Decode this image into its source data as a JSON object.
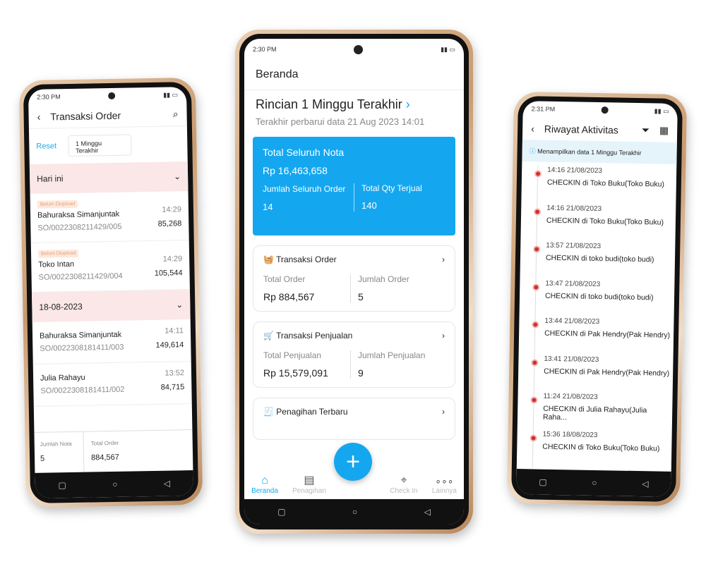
{
  "left": {
    "time": "2:30 PM",
    "title": "Transaksi Order",
    "reset": "Reset",
    "filter": "1 Minggu Terakhir",
    "groups": [
      {
        "label": "Hari ini",
        "orders": [
          {
            "badge": "Belum Diupload",
            "name": "Bahuraksa Simanjuntak",
            "time": "14:29",
            "so": "SO/0022308211429/005",
            "amount": "85,268"
          },
          {
            "badge": "Belum Diupload",
            "name": "Toko Intan",
            "time": "14:29",
            "so": "SO/0022308211429/004",
            "amount": "105,544"
          }
        ]
      },
      {
        "label": "18-08-2023",
        "orders": [
          {
            "name": "Bahuraksa Simanjuntak",
            "time": "14:11",
            "so": "SO/0022308181411/003",
            "amount": "149,614"
          },
          {
            "name": "Julia Rahayu",
            "time": "13:52",
            "so": "SO/0022308181411/002",
            "amount": "84,715"
          }
        ]
      }
    ],
    "footer": {
      "nota_label": "Jumlah Nota",
      "nota": "5",
      "total_label": "Total Order",
      "total": "884,567"
    }
  },
  "middle": {
    "time": "2:30 PM",
    "title": "Beranda",
    "heading": "Rincian 1 Minggu Terakhir",
    "updated": "Terakhir perbarui data 21 Aug 2023 14:01",
    "summary": {
      "label": "Total Seluruh Nota",
      "value": "Rp 16,463,658",
      "a_label": "Jumlah Seluruh Order",
      "a": "14",
      "b_label": "Total Qty Terjual",
      "b": "140"
    },
    "cards": [
      {
        "title": "Transaksi Order",
        "l_label": "Total Order",
        "l": "Rp 884,567",
        "r_label": "Jumlah Order",
        "r": "5"
      },
      {
        "title": "Transaksi Penjualan",
        "l_label": "Total Penjualan",
        "l": "Rp 15,579,091",
        "r_label": "Jumlah Penjualan",
        "r": "9"
      },
      {
        "title": "Penagihan Terbaru"
      }
    ],
    "nav": [
      "Beranda",
      "Penagihan",
      "Check In",
      "Lainnya"
    ],
    "accent": "#14a7f0"
  },
  "right": {
    "time": "2:31 PM",
    "title": "Riwayat Aktivitas",
    "info": "Menampilkan data 1 Minggu Terakhir",
    "items": [
      {
        "t": "14:16 21/08/2023",
        "d": "CHECKIN di Toko Buku(Toko Buku)"
      },
      {
        "t": "14:16 21/08/2023",
        "d": "CHECKIN di Toko Buku(Toko Buku)"
      },
      {
        "t": "13:57 21/08/2023",
        "d": "CHECKIN di toko budi(toko budi)"
      },
      {
        "t": "13:47 21/08/2023",
        "d": "CHECKIN di toko budi(toko budi)"
      },
      {
        "t": "13:44 21/08/2023",
        "d": "CHECKIN di Pak Hendry(Pak Hendry)"
      },
      {
        "t": "13:41 21/08/2023",
        "d": "CHECKIN di Pak Hendry(Pak Hendry)"
      },
      {
        "t": "11:24 21/08/2023",
        "d": "CHECKIN di Julia Rahayu(Julia Raha..."
      },
      {
        "t": "15:36 18/08/2023",
        "d": "CHECKIN di Toko Buku(Toko Buku)"
      }
    ]
  }
}
